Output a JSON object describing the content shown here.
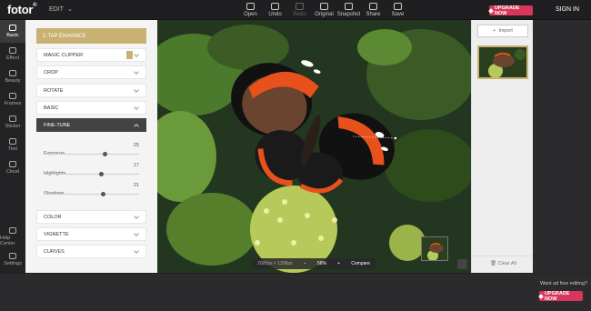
{
  "app": {
    "logo": "fotor",
    "edit_menu": "EDIT"
  },
  "toolbar": {
    "tools": [
      {
        "label": "Open",
        "icon": "open-icon"
      },
      {
        "label": "Undo",
        "icon": "undo-icon"
      },
      {
        "label": "Redo",
        "icon": "redo-icon",
        "disabled": true
      },
      {
        "label": "Original",
        "icon": "original-icon"
      },
      {
        "label": "Snapshot",
        "icon": "snapshot-icon"
      },
      {
        "label": "Share",
        "icon": "share-icon"
      },
      {
        "label": "Save",
        "icon": "save-icon"
      }
    ],
    "upgrade_label": "UPGRADE NOW",
    "signin_label": "SIGN IN"
  },
  "leftnav": {
    "items": [
      {
        "label": "Basic",
        "icon": "sliders-icon"
      },
      {
        "label": "Effect",
        "icon": "effect-icon"
      },
      {
        "label": "Beauty",
        "icon": "beauty-icon"
      },
      {
        "label": "Frames",
        "icon": "frames-icon"
      },
      {
        "label": "Sticker",
        "icon": "sticker-icon"
      },
      {
        "label": "Text",
        "icon": "text-icon"
      },
      {
        "label": "Cloud",
        "icon": "cloud-icon"
      }
    ],
    "bottom_items": [
      {
        "label": "Help Center",
        "icon": "help-icon"
      },
      {
        "label": "Settings",
        "icon": "gear-icon"
      }
    ]
  },
  "panel": {
    "one_tap": "1-TAP ENHANCE",
    "sections_top": [
      "MAGIC CLIPPER",
      "CROP",
      "ROTATE",
      "BASIC"
    ],
    "open_section": "FINE-TUNE",
    "sliders": [
      {
        "label": "Exposure",
        "value": "25",
        "level": 0.64
      },
      {
        "label": "Highlights",
        "value": "17",
        "level": 0.6
      },
      {
        "label": "Shadows",
        "value": "21",
        "level": 0.62
      }
    ],
    "sections_bottom": [
      "COLOR",
      "VIGNETTE",
      "CURVES"
    ]
  },
  "canvas": {
    "dimensions": "2000px × 1398px",
    "zoom": "56%",
    "compare_label": "Compare"
  },
  "rightpanel": {
    "import_label": "Import",
    "clear_label": "Clear All"
  },
  "footer": {
    "adfree_text": "Want ad free editing?",
    "upgrade_label": "UPGRADE NOW"
  },
  "colors": {
    "accent": "#c9b171",
    "upgrade": "#d8365b",
    "dark": "#2b2b2d"
  }
}
